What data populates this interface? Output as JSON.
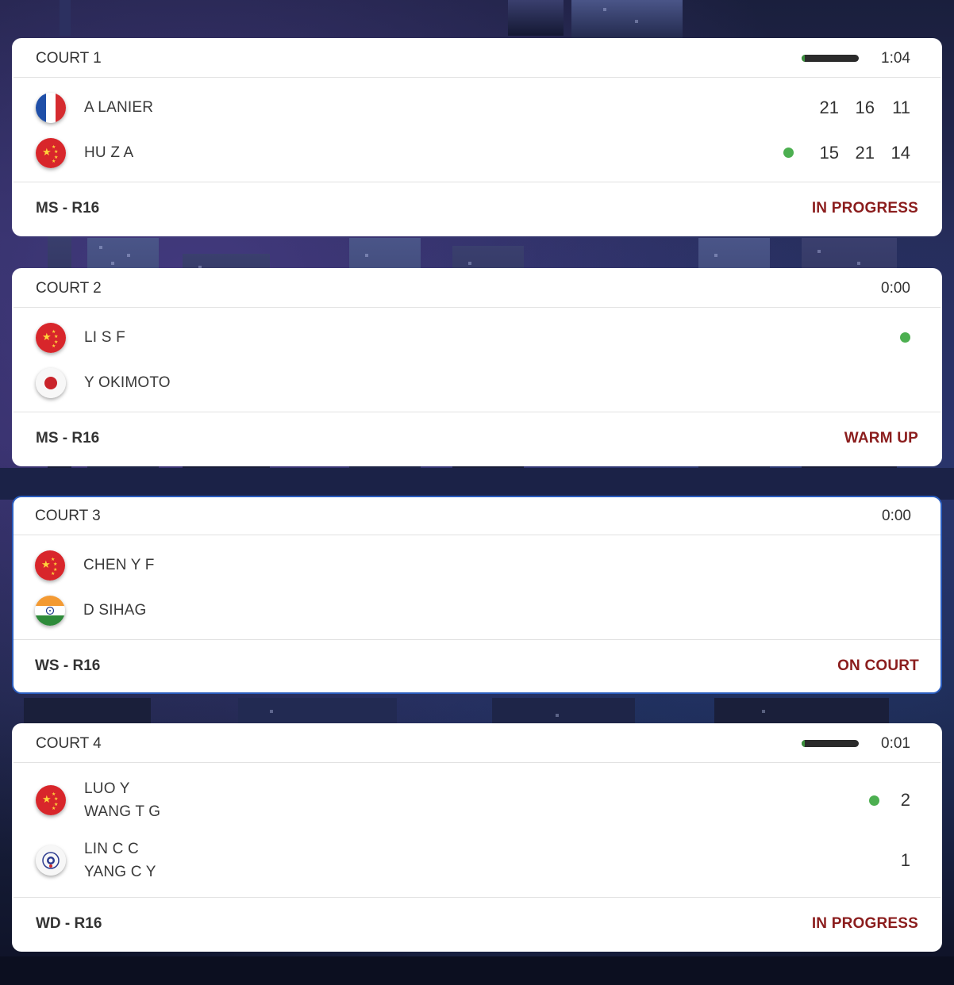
{
  "courts": [
    {
      "name": "COURT 1",
      "timer": "1:04",
      "progress": 0.05,
      "event": "MS - R16",
      "status": "IN PROGRESS",
      "players": [
        {
          "names": [
            "A LANIER"
          ],
          "flag": "france-flag-icon",
          "serving": false,
          "scores": [
            "21",
            "16",
            "11"
          ]
        },
        {
          "names": [
            "HU Z A"
          ],
          "flag": "china-flag-icon",
          "serving": true,
          "scores": [
            "15",
            "21",
            "14"
          ]
        }
      ]
    },
    {
      "name": "COURT 2",
      "timer": "0:00",
      "event": "MS - R16",
      "status": "WARM UP",
      "players": [
        {
          "names": [
            "LI S F"
          ],
          "flag": "china-flag-icon",
          "serving": true,
          "scores": []
        },
        {
          "names": [
            "Y OKIMOTO"
          ],
          "flag": "japan-flag-icon",
          "serving": false,
          "scores": []
        }
      ]
    },
    {
      "name": "COURT 3",
      "timer": "0:00",
      "event": "WS - R16",
      "status": "ON COURT",
      "players": [
        {
          "names": [
            "CHEN Y F"
          ],
          "flag": "china-flag-icon",
          "serving": false,
          "scores": []
        },
        {
          "names": [
            "D SIHAG"
          ],
          "flag": "india-flag-icon",
          "serving": false,
          "scores": []
        }
      ]
    },
    {
      "name": "COURT 4",
      "timer": "0:01",
      "progress": 0.05,
      "event": "WD - R16",
      "status": "IN PROGRESS",
      "players": [
        {
          "names": [
            "LUO Y",
            "WANG T G"
          ],
          "flag": "china-flag-icon",
          "serving": true,
          "scores": [
            "2"
          ]
        },
        {
          "names": [
            "LIN C C",
            "YANG C Y"
          ],
          "flag": "chinese-taipei-flag-icon",
          "serving": false,
          "scores": [
            "1"
          ]
        }
      ]
    }
  ],
  "colors": {
    "status_text": "#8b1d1d",
    "serve_dot": "#4caf50",
    "selected_border": "#2a5dbf",
    "progress_fill": "#3b8f3d",
    "progress_track": "#2b2b2b"
  }
}
